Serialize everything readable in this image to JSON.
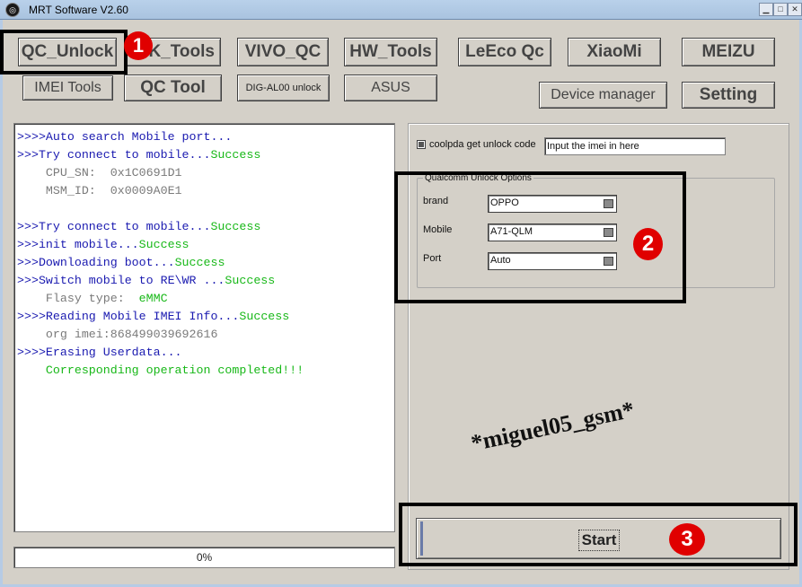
{
  "window": {
    "title": "MRT Software V2.60",
    "icon": "app-logo-icon",
    "controls": [
      "minimize-icon",
      "maximize-icon",
      "close-icon"
    ]
  },
  "toolbar": {
    "row1": [
      "QC_Unlock",
      "K_Tools",
      "VIVO_QC",
      "HW_Tools",
      "LeEco Qc",
      "XiaoMi",
      "MEIZU"
    ],
    "row2": [
      "IMEI Tools",
      "QC Tool",
      "DIG-AL00 unlock",
      "ASUS",
      "Device manager",
      "Setting"
    ]
  },
  "annotations": {
    "marker1": "1",
    "marker2": "2",
    "marker3": "3",
    "highlight_color": "#000000",
    "marker_color": "#e00000"
  },
  "log": {
    "lines": [
      {
        "parts": [
          {
            "t": ">>>>Auto search Mobile port...",
            "c": "blue"
          }
        ]
      },
      {
        "parts": [
          {
            "t": ">>>Try connect to mobile...",
            "c": "blue"
          },
          {
            "t": "Success",
            "c": "green"
          }
        ]
      },
      {
        "parts": [
          {
            "t": "    CPU_SN:  0x1C0691D1",
            "c": "gray"
          }
        ]
      },
      {
        "parts": [
          {
            "t": "    MSM_ID:  0x0009A0E1",
            "c": "gray"
          }
        ]
      },
      {
        "parts": [
          {
            "t": "",
            "c": "gray"
          }
        ]
      },
      {
        "parts": [
          {
            "t": ">>>Try connect to mobile...",
            "c": "blue"
          },
          {
            "t": "Success",
            "c": "green"
          }
        ]
      },
      {
        "parts": [
          {
            "t": ">>>init mobile...",
            "c": "blue"
          },
          {
            "t": "Success",
            "c": "green"
          }
        ]
      },
      {
        "parts": [
          {
            "t": ">>>Downloading boot...",
            "c": "blue"
          },
          {
            "t": "Success",
            "c": "green"
          }
        ]
      },
      {
        "parts": [
          {
            "t": ">>>Switch mobile to RE\\WR ...",
            "c": "blue"
          },
          {
            "t": "Success",
            "c": "green"
          }
        ]
      },
      {
        "parts": [
          {
            "t": "    Flasy type:  ",
            "c": "gray"
          },
          {
            "t": "eMMC",
            "c": "green"
          }
        ]
      },
      {
        "parts": [
          {
            "t": ">>>>Reading Mobile IMEI Info...",
            "c": "blue"
          },
          {
            "t": "Success",
            "c": "green"
          }
        ]
      },
      {
        "parts": [
          {
            "t": "    org imei:868499039692616",
            "c": "gray"
          }
        ]
      },
      {
        "parts": [
          {
            "t": ">>>>Erasing Userdata...",
            "c": "blue"
          }
        ]
      },
      {
        "parts": [
          {
            "t": "    Corresponding operation completed!!!",
            "c": "green"
          }
        ]
      }
    ]
  },
  "progress": {
    "value": 0,
    "label": "0%"
  },
  "options": {
    "coolpda_label": "coolpda get unlock code",
    "imei_value": "Input the imei in here",
    "group_title": "Qualcomm Unlock Options",
    "brand_label": "brand",
    "brand_value": "OPPO",
    "mobile_label": "Mobile",
    "mobile_value": "A71-QLM",
    "port_label": "Port",
    "port_value": "Auto"
  },
  "watermark": "*miguel05_gsm*",
  "start_label": "Start"
}
